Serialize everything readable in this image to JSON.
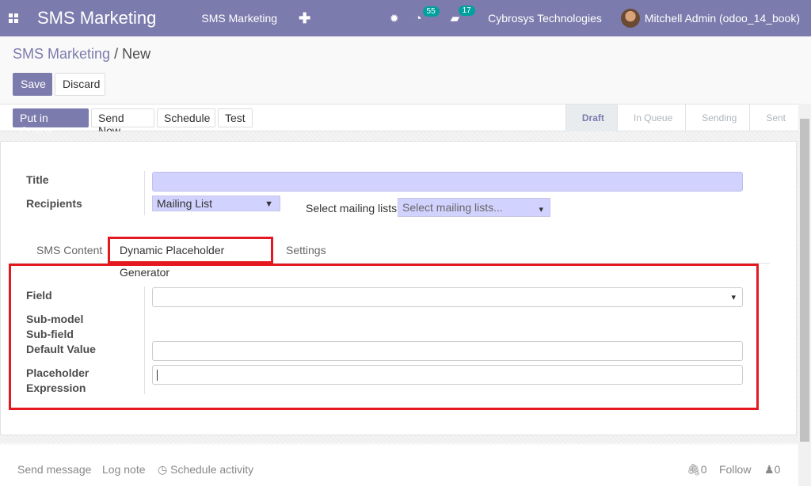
{
  "navbar": {
    "app_name": "SMS Marketing",
    "menu_item": "SMS Marketing",
    "plus": "✚",
    "bug": "✹",
    "activity_badge": "55",
    "message_badge": "17",
    "company": "Cybrosys Technologies",
    "user": "Mitchell Admin (odoo_14_book)"
  },
  "breadcrumb": {
    "parent": "SMS Marketing",
    "separator": "/",
    "current": "New"
  },
  "actions": {
    "save": "Save",
    "discard": "Discard"
  },
  "statusbar": {
    "buttons": [
      "Put in Queue",
      "Send Now",
      "Schedule",
      "Test"
    ],
    "stages": [
      "Draft",
      "In Queue",
      "Sending",
      "Sent"
    ],
    "active_stage": "Draft"
  },
  "form": {
    "title_label": "Title",
    "title_value": "",
    "recipients_label": "Recipients",
    "recipients_value": "Mailing List",
    "mailing_lists_label": "Select mailing lists:",
    "mailing_lists_placeholder": "Select mailing lists...",
    "tabs": [
      "SMS Content",
      "Dynamic Placeholder Generator",
      "Settings"
    ],
    "active_tab": "Dynamic Placeholder Generator",
    "field_label": "Field",
    "submodel_label": "Sub-model",
    "subfield_label": "Sub-field",
    "default_value_label": "Default Value",
    "placeholder_label_1": "Placeholder",
    "placeholder_label_2": "Expression"
  },
  "chatter": {
    "send_message": "Send message",
    "log_note": "Log note",
    "schedule_activity": "Schedule activity",
    "attachments_count": "0",
    "follow": "Follow",
    "followers_count": "0"
  },
  "colors": {
    "brand": "#7c7bad",
    "highlight": "#e3191f",
    "badge": "#00a09d",
    "required_field": "#d2d2ff"
  }
}
